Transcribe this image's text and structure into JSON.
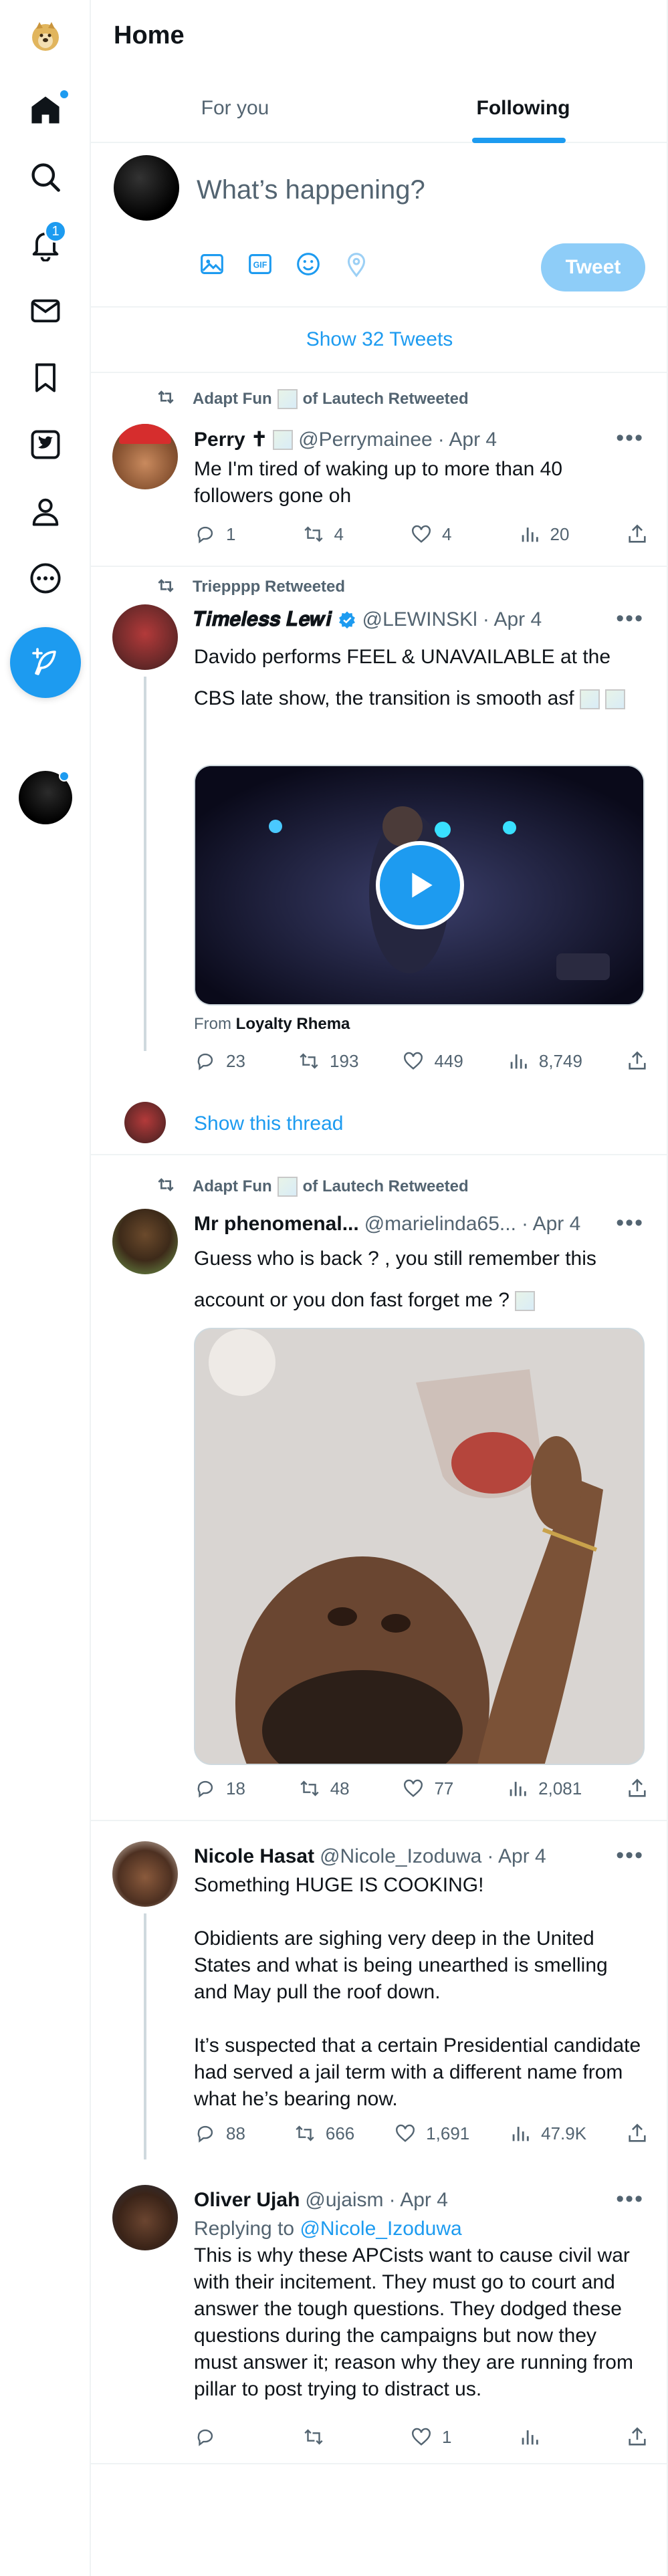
{
  "nav": {
    "items": [
      {
        "name": "logo",
        "icon": "doge-logo-icon"
      },
      {
        "name": "home",
        "icon": "home-icon"
      },
      {
        "name": "explore",
        "icon": "search-icon"
      },
      {
        "name": "notifications",
        "icon": "bell-icon",
        "badge": "1"
      },
      {
        "name": "messages",
        "icon": "mail-icon"
      },
      {
        "name": "bookmarks",
        "icon": "bookmark-icon"
      },
      {
        "name": "twitter-blue",
        "icon": "bird-square-icon"
      },
      {
        "name": "profile",
        "icon": "person-icon"
      },
      {
        "name": "more",
        "icon": "more-circle-icon"
      }
    ],
    "accent": "#1d9bf0"
  },
  "header": {
    "title": "Home"
  },
  "tabs": [
    {
      "label": "For you",
      "active": false
    },
    {
      "label": "Following",
      "active": true
    }
  ],
  "composer": {
    "placeholder": "What’s happening?",
    "tweet_label": "Tweet"
  },
  "show_tweets": "Show 32 Tweets",
  "tweets": [
    {
      "retweeted_by": "Adapt Fun",
      "retweeted_suffix": "of Lautech Retweeted",
      "name": "Perry ✝",
      "handle": "@Perrymainee",
      "date": "· Apr 4",
      "text": "Me I'm tired of waking up to more than 40 followers gone oh",
      "replies": "1",
      "retweets": "4",
      "likes": "4",
      "views": "20"
    },
    {
      "retweeted_by": "Triepppp Retweeted",
      "name": "𝑻𝒊𝒎𝒆𝒍𝒆𝒔𝒔 𝑳𝒆𝒘𝒊",
      "handle": "@LEWINSKl",
      "date": "· Apr 4",
      "text": "Davido performs FEEL & UNAVAILABLE at the CBS late show, the transition is smooth asf",
      "from_label": "From",
      "from_name": "Loyalty Rhema",
      "replies": "23",
      "retweets": "193",
      "likes": "449",
      "views": "8,749",
      "show_thread": "Show this thread"
    },
    {
      "retweeted_by": "Adapt Fun",
      "retweeted_suffix": "of Lautech Retweeted",
      "name": "Mr phenomenal...",
      "handle": "@marielinda65...",
      "date": "· Apr 4",
      "text": "Guess who is back ? , you still remember this account or you don fast forget me ?",
      "replies": "18",
      "retweets": "48",
      "likes": "77",
      "views": "2,081"
    },
    {
      "name": "Nicole Hasat",
      "handle": "@Nicole_Izoduwa",
      "date": "· Apr 4",
      "paragraphs": [
        "Something HUGE IS COOKING!",
        "Obidients are sighing very deep in the United States and what is being unearthed is smelling and May pull the roof down.",
        "It’s suspected that a certain Presidential candidate had served a jail term with a different name from what he’s bearing now."
      ],
      "replies": "88",
      "retweets": "666",
      "likes": "1,691",
      "views": "47.9K"
    },
    {
      "name": "Oliver Ujah",
      "handle": "@ujaism",
      "date": "· Apr 4",
      "replying_label": "Replying to",
      "replying_to": "@Nicole_Izoduwa",
      "text": "This is why these APCists want to cause civil war with their incitement. They must go to court and answer the tough questions. They dodged these questions during the campaigns but now they must answer it; reason why they are running from pillar to post trying to distract us.",
      "replies": "",
      "retweets": "",
      "likes": "1",
      "views": ""
    }
  ]
}
